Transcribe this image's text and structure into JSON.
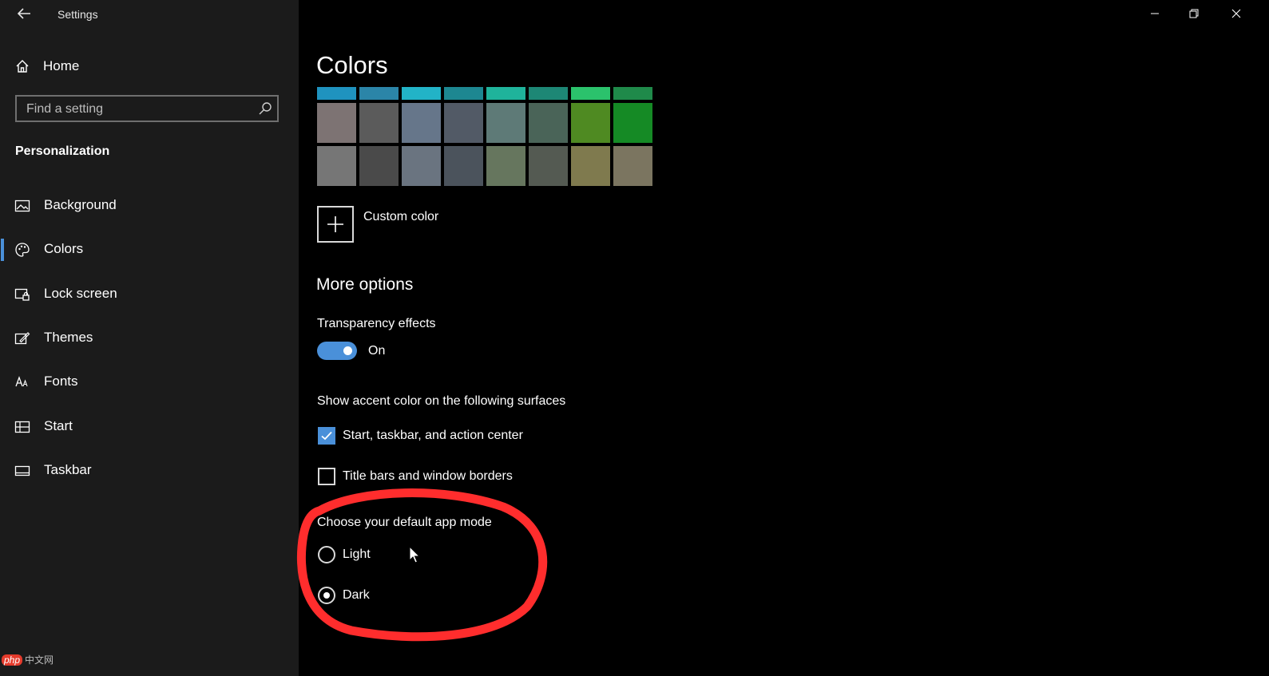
{
  "window": {
    "title": "Settings"
  },
  "sidebar": {
    "home_label": "Home",
    "search_placeholder": "Find a setting",
    "section": "Personalization",
    "items": [
      {
        "label": "Background",
        "icon": "image-icon",
        "active": false
      },
      {
        "label": "Colors",
        "icon": "palette-icon",
        "active": true
      },
      {
        "label": "Lock screen",
        "icon": "lock-screen-icon",
        "active": false
      },
      {
        "label": "Themes",
        "icon": "themes-icon",
        "active": false
      },
      {
        "label": "Fonts",
        "icon": "fonts-icon",
        "active": false
      },
      {
        "label": "Start",
        "icon": "start-icon",
        "active": false
      },
      {
        "label": "Taskbar",
        "icon": "taskbar-icon",
        "active": false
      }
    ]
  },
  "main": {
    "title": "Colors",
    "swatch_row_top": [
      "#1f93bf",
      "#2b85a8",
      "#22b3c7",
      "#1d8791",
      "#1fb39b",
      "#1d8775",
      "#2bc26c",
      "#1f8a4a"
    ],
    "swatch_row_mid": [
      "#7d7373",
      "#5b5b5b",
      "#66768a",
      "#525a66",
      "#5e7a77",
      "#4a6458",
      "#4f8a22",
      "#158a25"
    ],
    "swatch_row_bot": [
      "#767676",
      "#4a4a4a",
      "#6a7480",
      "#4b535c",
      "#66765e",
      "#545a52",
      "#7f7a4e",
      "#7b7560"
    ],
    "custom_color_label": "Custom color",
    "more_options_title": "More options",
    "transparency_label": "Transparency effects",
    "transparency_state": "On",
    "surfaces_label": "Show accent color on the following surfaces",
    "surfaces": [
      {
        "label": "Start, taskbar, and action center",
        "checked": true
      },
      {
        "label": "Title bars and window borders",
        "checked": false
      }
    ],
    "app_mode_label": "Choose your default app mode",
    "app_modes": [
      {
        "label": "Light",
        "selected": false
      },
      {
        "label": "Dark",
        "selected": true
      }
    ]
  },
  "colors": {
    "accent": "#4a90d9",
    "annotation": "#ff2d2d"
  },
  "watermark": {
    "brand": "php",
    "text": "中文网"
  }
}
